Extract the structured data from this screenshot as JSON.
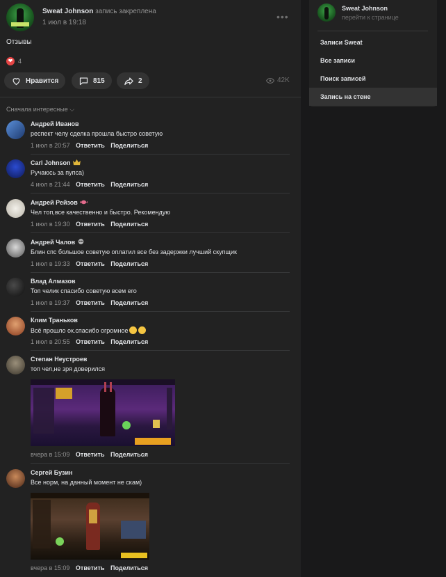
{
  "post": {
    "author": "Sweat Johnson",
    "action": "запись закреплена",
    "date": "1 июл в 19:18",
    "more": "•••",
    "text": "Отзывы",
    "reactions_count": "4",
    "like_label": "Нравится",
    "comments_count": "815",
    "shares_count": "2",
    "views": "42K",
    "sort_label": "Сначала интересные"
  },
  "comments": [
    {
      "name": "Андрей Иванов",
      "text": "респект челу сделка прошла быстро советую",
      "date": "1 июл в 20:57",
      "reply": "Ответить",
      "share": "Поделиться"
    },
    {
      "name": "Carl Johnson",
      "text": "Ручаюсь за пупса)",
      "date": "4 июл в 21:44",
      "reply": "Ответить",
      "share": "Поделиться"
    },
    {
      "name": "Андрей Рейзов",
      "text": "Чел топ,все качественно и быстро. Рекомендую",
      "date": "1 июл в 19:30",
      "reply": "Ответить",
      "share": "Поделиться"
    },
    {
      "name": "Андрей Чалов",
      "text": "Блин спс большое советую оплатил все без задержки лучший скупщик",
      "date": "1 июл в 19:33",
      "reply": "Ответить",
      "share": "Поделиться"
    },
    {
      "name": "Влад Алмазов",
      "text": "Топ челик спасибо советую всем его",
      "date": "1 июл в 19:37",
      "reply": "Ответить",
      "share": "Поделиться"
    },
    {
      "name": "Клим Траньков",
      "text": "Всё прошло ок.спасибо огромное",
      "date": "1 июл в 20:55",
      "reply": "Ответить",
      "share": "Поделиться"
    },
    {
      "name": "Степан Неустроев",
      "text": "топ чел,не зря доверился",
      "date": "вчера в 15:09",
      "reply": "Ответить",
      "share": "Поделиться"
    },
    {
      "name": "Сергей Бузин",
      "text": "Все норм, на данный момент не скам)",
      "date": "вчера в 15:09",
      "reply": "Ответить",
      "share": "Поделиться"
    }
  ],
  "sidebar": {
    "title": "Sweat Johnson",
    "subtitle": "перейти к странице",
    "items": [
      {
        "label": "Записи Sweat"
      },
      {
        "label": "Все записи"
      },
      {
        "label": "Поиск записей"
      },
      {
        "label": "Запись на стене"
      }
    ]
  },
  "colors": {
    "background": "#19191a",
    "panel": "#222222",
    "pill": "#333333",
    "accent_heart": "#e64646",
    "muted_text": "#939393"
  }
}
